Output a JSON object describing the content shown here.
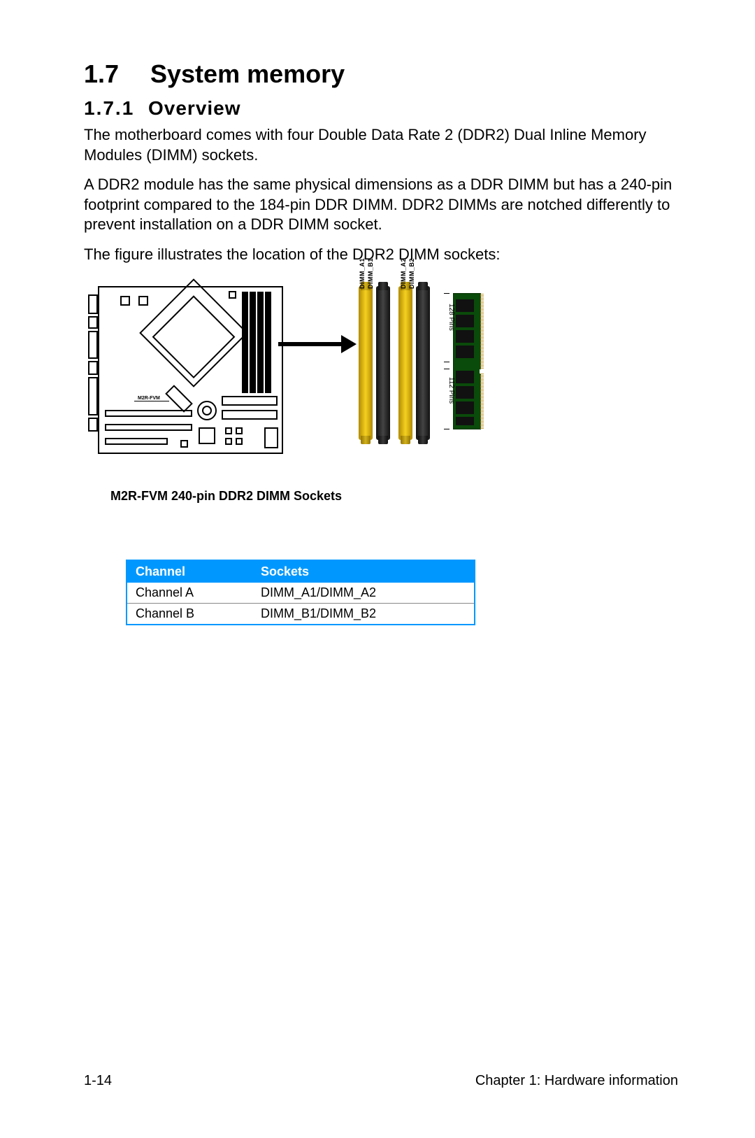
{
  "heading": {
    "number": "1.7",
    "title": "System memory"
  },
  "subheading": {
    "number": "1.7.1",
    "title": "Overview"
  },
  "paragraphs": {
    "p1": "The motherboard comes with four Double Data Rate 2 (DDR2) Dual Inline Memory Modules (DIMM) sockets.",
    "p2": "A DDR2 module has the same physical dimensions as a DDR DIMM but has a 240-pin footprint compared to the 184-pin DDR DIMM. DDR2 DIMMs are notched differently to prevent installation on a DDR DIMM socket.",
    "p3": "The figure illustrates the location of the DDR2 DIMM sockets:"
  },
  "figure": {
    "board_model": "M2R-FVM",
    "dimm_labels": {
      "a1": "DIMM_A1",
      "b1": "DIMM_B1",
      "a2": "DIMM_A2",
      "b2": "DIMM_B2"
    },
    "pin_labels": {
      "top": "128 Pins",
      "bottom": "112 Pins"
    },
    "caption": "M2R-FVM 240-pin DDR2 DIMM Sockets"
  },
  "table": {
    "headers": {
      "c0": "Channel",
      "c1": "Sockets"
    },
    "rows": [
      {
        "c0": "Channel A",
        "c1": "DIMM_A1/DIMM_A2"
      },
      {
        "c0": "Channel B",
        "c1": "DIMM_B1/DIMM_B2"
      }
    ]
  },
  "footer": {
    "page": "1-14",
    "chapter": "Chapter 1: Hardware information"
  }
}
